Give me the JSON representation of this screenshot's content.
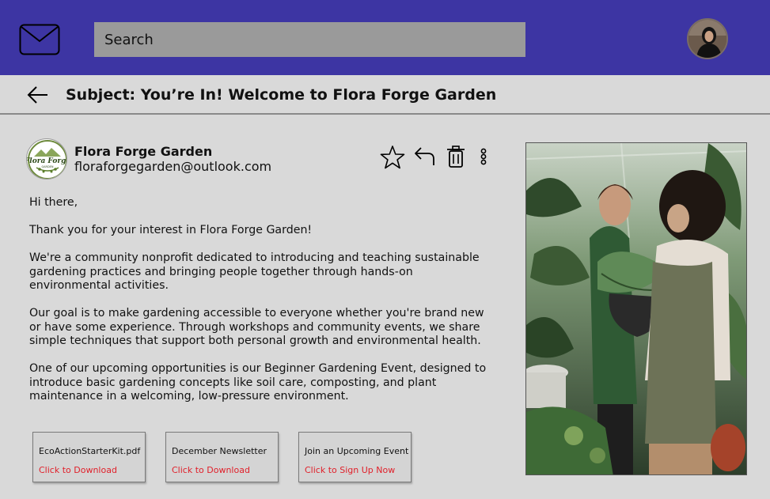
{
  "header": {
    "search_placeholder": "Search"
  },
  "email": {
    "subject": "Subject: You’re In! Welcome to Flora Forge Garden",
    "sender_name": "Flora Forge Garden",
    "sender_email": "floraforgegarden@outlook.com",
    "logo_text": "Flora Forge",
    "logo_subtext": "GARDEN",
    "paragraphs": [
      "Hi there,",
      "Thank you for your interest in Flora Forge Garden!",
      "We're a community nonprofit dedicated to introducing and teaching sustainable gardening practices and bringing people together through hands-on environmental activities.",
      "Our goal is to make gardening accessible to everyone whether you're brand new or have some experience. Through workshops and community events, we share simple techniques that support both personal growth and environmental health.",
      "One of our upcoming opportunities is our Beginner Gardening Event, designed to introduce basic gardening concepts like soil care, composting, and plant maintenance in a welcoming, low-pressure environment."
    ]
  },
  "actions": {
    "icons": [
      "star-icon",
      "reply-icon",
      "trash-icon",
      "more-vertical-icon"
    ]
  },
  "attachments": [
    {
      "title": "EcoActionStarterKit.pdf",
      "action": "Click to Download"
    },
    {
      "title": "December Newsletter",
      "action": "Click to Download"
    },
    {
      "title": "Join an Upcoming Event",
      "action": "Click to Sign Up Now"
    }
  ],
  "colors": {
    "header": "#3d35a3",
    "search": "#9a9a9a",
    "background": "#d9d9d9",
    "link_red": "#e0202a"
  }
}
